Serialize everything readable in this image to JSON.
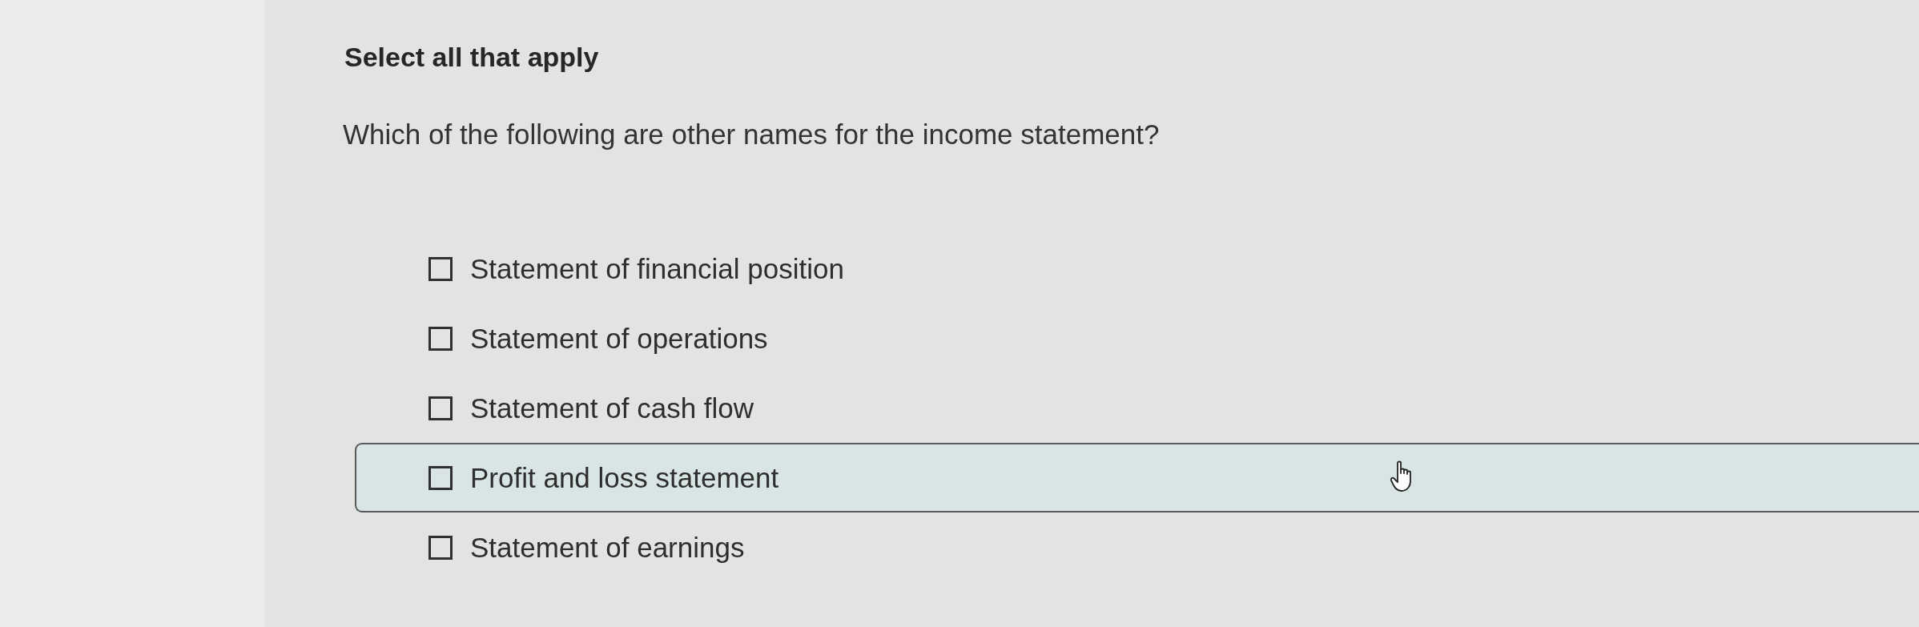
{
  "heading": "Select all that apply",
  "question": "Which of the following are other names for the income statement?",
  "options": [
    {
      "label": "Statement of financial position",
      "checked": false,
      "highlighted": false
    },
    {
      "label": "Statement of operations",
      "checked": false,
      "highlighted": false
    },
    {
      "label": "Statement of cash flow",
      "checked": false,
      "highlighted": false
    },
    {
      "label": "Profit and loss statement",
      "checked": false,
      "highlighted": true
    },
    {
      "label": "Statement of earnings",
      "checked": false,
      "highlighted": false
    }
  ]
}
